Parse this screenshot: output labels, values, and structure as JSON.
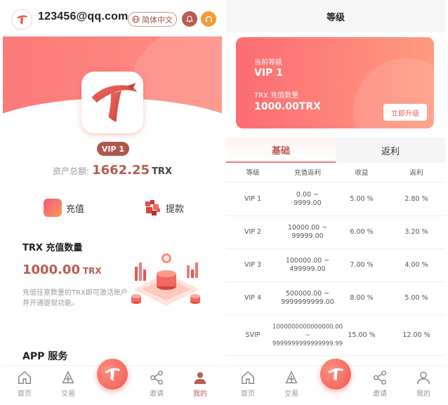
{
  "left": {
    "header": {
      "email": "123456@qq.com",
      "language": "简体中文"
    },
    "vip_badge": "VIP 1",
    "assets": {
      "label": "资产总额:",
      "value": "1662.25",
      "unit": "TRX"
    },
    "actions": {
      "recharge": "充值",
      "withdraw": "提款"
    },
    "trx_card": {
      "title": "TRX 充值数量",
      "amount": "1000.00",
      "unit": "TRX",
      "description": "充值任意数量的TRX即可激活账户并开通提现功能。"
    },
    "app_service_title": "APP 服务",
    "tabbar": {
      "home": "首页",
      "trade": "交易",
      "invite": "邀请",
      "mine": "我的"
    }
  },
  "right": {
    "title": "等级",
    "level_card": {
      "current_level_label": "当前等级",
      "current_level": "VIP 1",
      "trx_label": "TRX 充值数量",
      "trx_amount": "1000.00TRX",
      "upgrade": "立即升级"
    },
    "tabs": [
      "基础",
      "返利"
    ],
    "table": {
      "headers": [
        "等级",
        "充值返利",
        "收益",
        "返利"
      ],
      "rows": [
        {
          "level": "VIP 1",
          "range": "0.00 ~\n9999.00",
          "income": "5.00 %",
          "rebate": "2.80 %"
        },
        {
          "level": "VIP 2",
          "range": "10000.00 ~\n99999.00",
          "income": "6.00 %",
          "rebate": "3.20 %"
        },
        {
          "level": "VIP 3",
          "range": "100000.00 ~\n499999.00",
          "income": "7.00 %",
          "rebate": "4.00 %"
        },
        {
          "level": "VIP 4",
          "range": "500000.00 ~\n9999999999.00",
          "income": "8.00 %",
          "rebate": "5.00 %"
        },
        {
          "level": "SVIP",
          "range": "1000000000000000.00\n~\n9999999999999999.99",
          "income": "15.00 %",
          "rebate": "12.00 %"
        }
      ]
    },
    "tabbar": {
      "home": "首页",
      "trade": "交易",
      "invite": "邀请",
      "mine": "我的"
    }
  },
  "colors": {
    "accent": "#b75c53",
    "gradient_start": "#fc6c74",
    "gradient_end": "#ff9a7f"
  }
}
